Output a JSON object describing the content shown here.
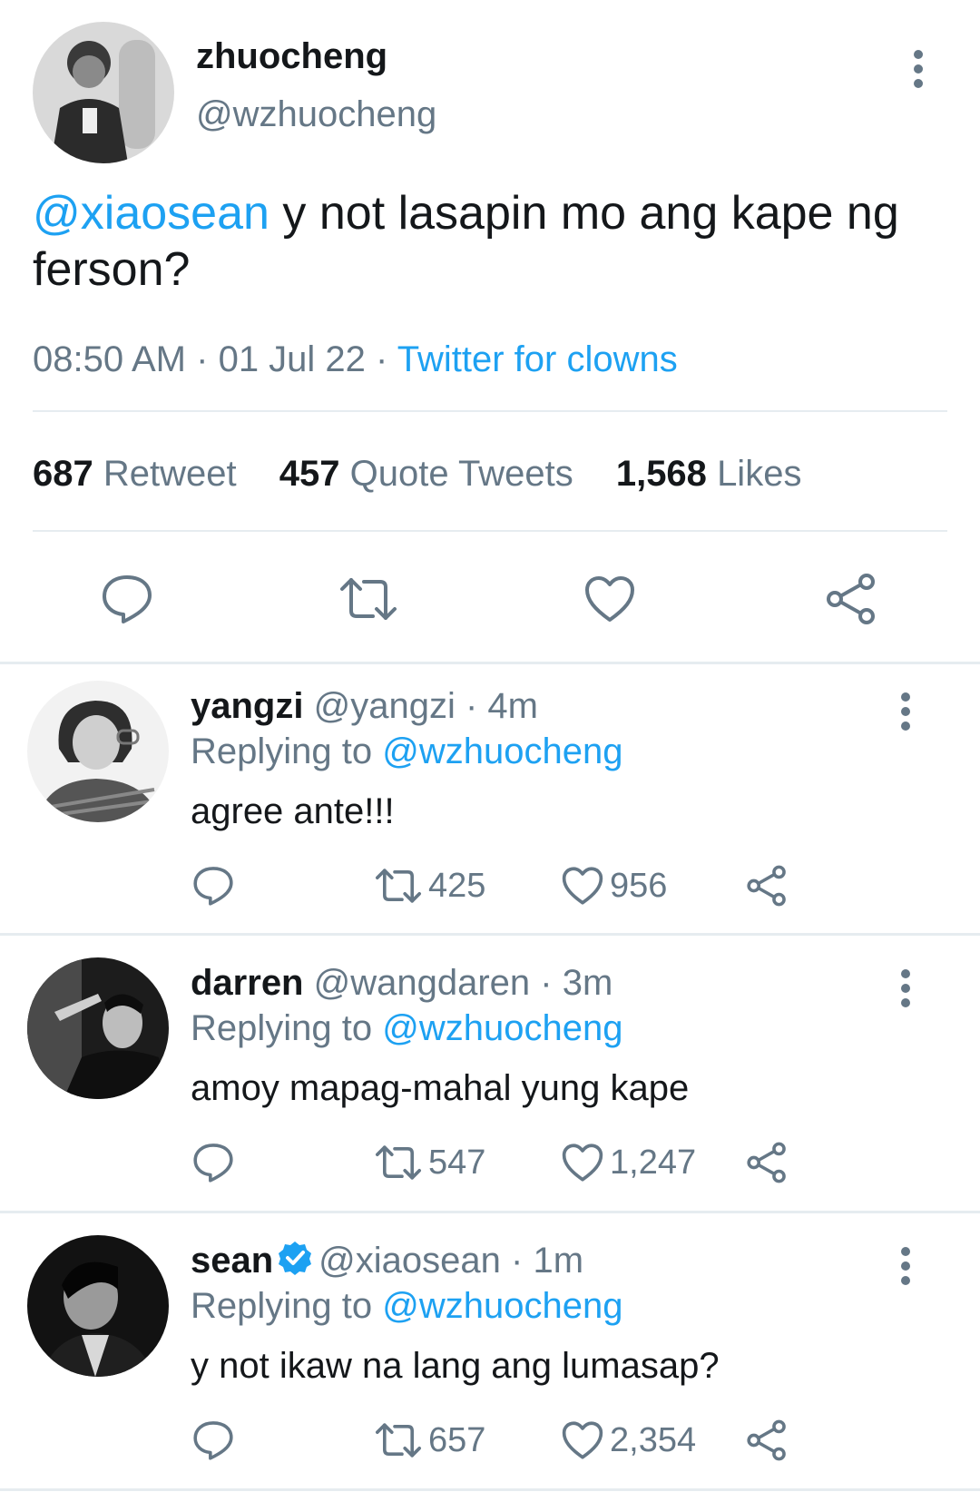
{
  "main": {
    "name": "zhuocheng",
    "handle": "@wzhuocheng",
    "mention": "@xiaosean",
    "text": " y not lasapin mo ang kape ng ferson?",
    "time": "08:50 AM",
    "date": "01 Jul 22",
    "source": "Twitter for clowns",
    "stats": {
      "retweets": "687",
      "retweets_label": "Retweet",
      "quotes": "457",
      "quotes_label": "Quote Tweets",
      "likes": "1,568",
      "likes_label": "Likes"
    }
  },
  "replies": [
    {
      "name": "yangzi",
      "handle": "@yangzi",
      "time": "4m",
      "replying_label": "Replying to",
      "replying_to": "@wzhuocheng",
      "text": "agree ante!!!",
      "retweets": "425",
      "likes": "956",
      "verified": false
    },
    {
      "name": "darren",
      "handle": "@wangdaren",
      "time": "3m",
      "replying_label": "Replying to",
      "replying_to": "@wzhuocheng",
      "text": "amoy mapag-mahal yung kape",
      "retweets": "547",
      "likes": "1,247",
      "verified": false
    },
    {
      "name": "sean",
      "handle": "@xiaosean",
      "time": "1m",
      "replying_label": "Replying to",
      "replying_to": "@wzhuocheng",
      "text": "y not ikaw na lang ang lumasap?",
      "retweets": "657",
      "likes": "2,354",
      "verified": true
    }
  ],
  "icons": {
    "reply": "reply-icon",
    "retweet": "retweet-icon",
    "like": "heart-icon",
    "share": "share-icon",
    "more": "more-vertical-icon",
    "verified": "verified-badge-icon"
  },
  "colors": {
    "link": "#1da1f2",
    "muted": "#657786",
    "text": "#14171a",
    "divider": "#e6ecf0"
  }
}
